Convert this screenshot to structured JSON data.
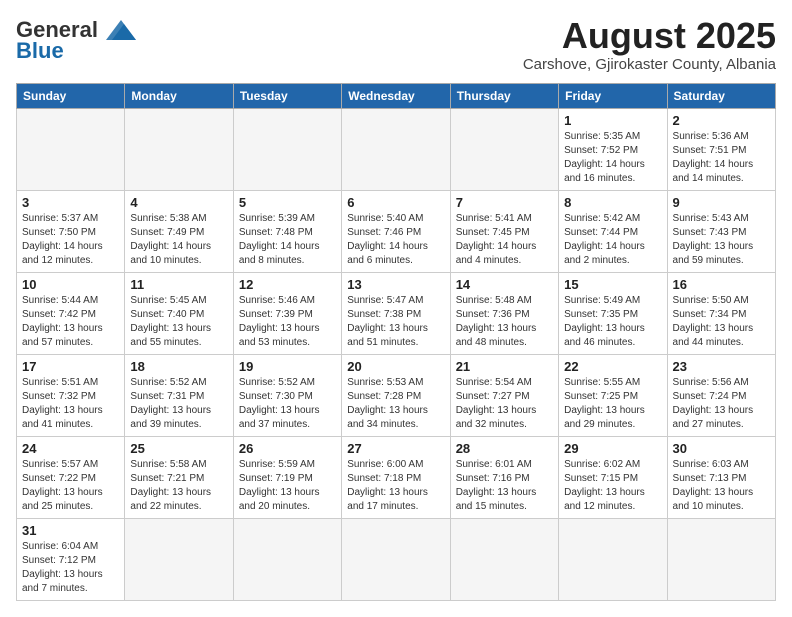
{
  "header": {
    "logo_line1": "General",
    "logo_line2": "Blue",
    "month_year": "August 2025",
    "location": "Carshove, Gjirokaster County, Albania"
  },
  "days_of_week": [
    "Sunday",
    "Monday",
    "Tuesday",
    "Wednesday",
    "Thursday",
    "Friday",
    "Saturday"
  ],
  "weeks": [
    [
      {
        "day": "",
        "info": ""
      },
      {
        "day": "",
        "info": ""
      },
      {
        "day": "",
        "info": ""
      },
      {
        "day": "",
        "info": ""
      },
      {
        "day": "",
        "info": ""
      },
      {
        "day": "1",
        "info": "Sunrise: 5:35 AM\nSunset: 7:52 PM\nDaylight: 14 hours and 16 minutes."
      },
      {
        "day": "2",
        "info": "Sunrise: 5:36 AM\nSunset: 7:51 PM\nDaylight: 14 hours and 14 minutes."
      }
    ],
    [
      {
        "day": "3",
        "info": "Sunrise: 5:37 AM\nSunset: 7:50 PM\nDaylight: 14 hours and 12 minutes."
      },
      {
        "day": "4",
        "info": "Sunrise: 5:38 AM\nSunset: 7:49 PM\nDaylight: 14 hours and 10 minutes."
      },
      {
        "day": "5",
        "info": "Sunrise: 5:39 AM\nSunset: 7:48 PM\nDaylight: 14 hours and 8 minutes."
      },
      {
        "day": "6",
        "info": "Sunrise: 5:40 AM\nSunset: 7:46 PM\nDaylight: 14 hours and 6 minutes."
      },
      {
        "day": "7",
        "info": "Sunrise: 5:41 AM\nSunset: 7:45 PM\nDaylight: 14 hours and 4 minutes."
      },
      {
        "day": "8",
        "info": "Sunrise: 5:42 AM\nSunset: 7:44 PM\nDaylight: 14 hours and 2 minutes."
      },
      {
        "day": "9",
        "info": "Sunrise: 5:43 AM\nSunset: 7:43 PM\nDaylight: 13 hours and 59 minutes."
      }
    ],
    [
      {
        "day": "10",
        "info": "Sunrise: 5:44 AM\nSunset: 7:42 PM\nDaylight: 13 hours and 57 minutes."
      },
      {
        "day": "11",
        "info": "Sunrise: 5:45 AM\nSunset: 7:40 PM\nDaylight: 13 hours and 55 minutes."
      },
      {
        "day": "12",
        "info": "Sunrise: 5:46 AM\nSunset: 7:39 PM\nDaylight: 13 hours and 53 minutes."
      },
      {
        "day": "13",
        "info": "Sunrise: 5:47 AM\nSunset: 7:38 PM\nDaylight: 13 hours and 51 minutes."
      },
      {
        "day": "14",
        "info": "Sunrise: 5:48 AM\nSunset: 7:36 PM\nDaylight: 13 hours and 48 minutes."
      },
      {
        "day": "15",
        "info": "Sunrise: 5:49 AM\nSunset: 7:35 PM\nDaylight: 13 hours and 46 minutes."
      },
      {
        "day": "16",
        "info": "Sunrise: 5:50 AM\nSunset: 7:34 PM\nDaylight: 13 hours and 44 minutes."
      }
    ],
    [
      {
        "day": "17",
        "info": "Sunrise: 5:51 AM\nSunset: 7:32 PM\nDaylight: 13 hours and 41 minutes."
      },
      {
        "day": "18",
        "info": "Sunrise: 5:52 AM\nSunset: 7:31 PM\nDaylight: 13 hours and 39 minutes."
      },
      {
        "day": "19",
        "info": "Sunrise: 5:52 AM\nSunset: 7:30 PM\nDaylight: 13 hours and 37 minutes."
      },
      {
        "day": "20",
        "info": "Sunrise: 5:53 AM\nSunset: 7:28 PM\nDaylight: 13 hours and 34 minutes."
      },
      {
        "day": "21",
        "info": "Sunrise: 5:54 AM\nSunset: 7:27 PM\nDaylight: 13 hours and 32 minutes."
      },
      {
        "day": "22",
        "info": "Sunrise: 5:55 AM\nSunset: 7:25 PM\nDaylight: 13 hours and 29 minutes."
      },
      {
        "day": "23",
        "info": "Sunrise: 5:56 AM\nSunset: 7:24 PM\nDaylight: 13 hours and 27 minutes."
      }
    ],
    [
      {
        "day": "24",
        "info": "Sunrise: 5:57 AM\nSunset: 7:22 PM\nDaylight: 13 hours and 25 minutes."
      },
      {
        "day": "25",
        "info": "Sunrise: 5:58 AM\nSunset: 7:21 PM\nDaylight: 13 hours and 22 minutes."
      },
      {
        "day": "26",
        "info": "Sunrise: 5:59 AM\nSunset: 7:19 PM\nDaylight: 13 hours and 20 minutes."
      },
      {
        "day": "27",
        "info": "Sunrise: 6:00 AM\nSunset: 7:18 PM\nDaylight: 13 hours and 17 minutes."
      },
      {
        "day": "28",
        "info": "Sunrise: 6:01 AM\nSunset: 7:16 PM\nDaylight: 13 hours and 15 minutes."
      },
      {
        "day": "29",
        "info": "Sunrise: 6:02 AM\nSunset: 7:15 PM\nDaylight: 13 hours and 12 minutes."
      },
      {
        "day": "30",
        "info": "Sunrise: 6:03 AM\nSunset: 7:13 PM\nDaylight: 13 hours and 10 minutes."
      }
    ],
    [
      {
        "day": "31",
        "info": "Sunrise: 6:04 AM\nSunset: 7:12 PM\nDaylight: 13 hours and 7 minutes."
      },
      {
        "day": "",
        "info": ""
      },
      {
        "day": "",
        "info": ""
      },
      {
        "day": "",
        "info": ""
      },
      {
        "day": "",
        "info": ""
      },
      {
        "day": "",
        "info": ""
      },
      {
        "day": "",
        "info": ""
      }
    ]
  ]
}
